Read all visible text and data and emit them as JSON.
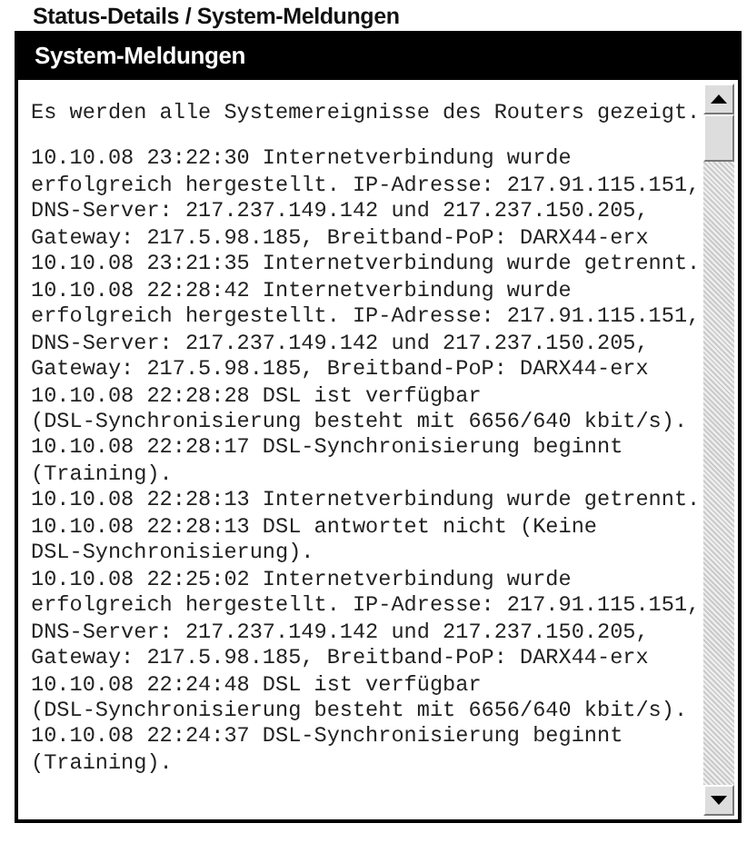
{
  "breadcrumb": "Status-Details / System-Meldungen",
  "panel": {
    "title": "System-Meldungen",
    "intro": "Es werden alle Systemereignisse des Routers gezeigt.",
    "messages": [
      "10.10.08 23:22:30 Internetverbindung wurde\nerfolgreich hergestellt. IP-Adresse: 217.91.115.151,\nDNS-Server: 217.237.149.142 und 217.237.150.205,\nGateway: 217.5.98.185, Breitband-PoP: DARX44-erx",
      "10.10.08 23:21:35 Internetverbindung wurde getrennt.",
      "10.10.08 22:28:42 Internetverbindung wurde\nerfolgreich hergestellt. IP-Adresse: 217.91.115.151,\nDNS-Server: 217.237.149.142 und 217.237.150.205,\nGateway: 217.5.98.185, Breitband-PoP: DARX44-erx",
      "10.10.08 22:28:28 DSL ist verfügbar\n(DSL-Synchronisierung besteht mit 6656/640 kbit/s).",
      "10.10.08 22:28:17 DSL-Synchronisierung beginnt\n(Training).",
      "10.10.08 22:28:13 Internetverbindung wurde getrennt.",
      "10.10.08 22:28:13 DSL antwortet nicht (Keine\nDSL-Synchronisierung).",
      "10.10.08 22:25:02 Internetverbindung wurde\nerfolgreich hergestellt. IP-Adresse: 217.91.115.151,\nDNS-Server: 217.237.149.142 und 217.237.150.205,\nGateway: 217.5.98.185, Breitband-PoP: DARX44-erx",
      "10.10.08 22:24:48 DSL ist verfügbar\n(DSL-Synchronisierung besteht mit 6656/640 kbit/s).",
      "10.10.08 22:24:37 DSL-Synchronisierung beginnt\n(Training)."
    ]
  }
}
